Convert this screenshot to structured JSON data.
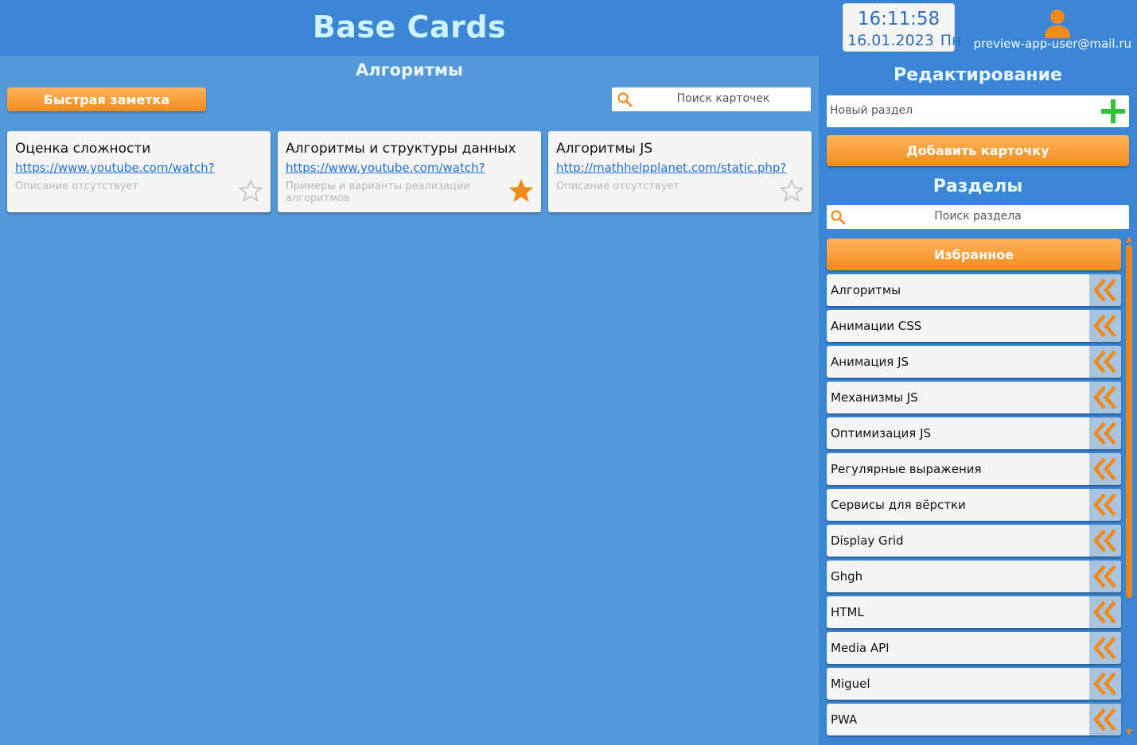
{
  "header": {
    "app_title": "Base Cards",
    "clock": {
      "time": "16:11:58",
      "date": "16.01.2023",
      "weekday": "Пн"
    },
    "user_email": "preview-app-user@mail.ru"
  },
  "main": {
    "section_title": "Алгоритмы",
    "quick_note_label": "Быстрая заметка",
    "search_placeholder": "Поиск карточек",
    "cards": [
      {
        "title": "Оценка сложности",
        "link": "https://www.youtube.com/watch?",
        "description": "Описание отсутствует",
        "favorite": false
      },
      {
        "title": "Алгоритмы и структуры данных",
        "link": "https://www.youtube.com/watch?",
        "description": "Примеры и варианты реализации алгоритмов",
        "favorite": true
      },
      {
        "title": "Алгоритмы JS",
        "link": "http://mathhelpplanet.com/static.php?",
        "description": "Описание отсутствует",
        "favorite": false
      }
    ]
  },
  "sidebar": {
    "edit_title": "Редактирование",
    "new_section_placeholder": "Новый раздел",
    "add_card_label": "Добавить карточку",
    "sections_title": "Разделы",
    "section_search_placeholder": "Поиск раздела",
    "favorites_label": "Избранное",
    "sections": [
      "Алгоритмы",
      "Анимации CSS",
      "Анимация JS",
      "Механизмы JS",
      "Оптимизация JS",
      "Регулярные выражения",
      "Сервисы для вёрстки",
      "Display Grid",
      "Ghgh",
      "HTML",
      "Media API",
      "Miguel",
      "PWA"
    ]
  },
  "colors": {
    "background": "#3a86d4",
    "main_panel": "#5498d9",
    "accent_orange": "#f28c1e",
    "title_text": "#cdf3ff",
    "link": "#1d6fd0"
  }
}
